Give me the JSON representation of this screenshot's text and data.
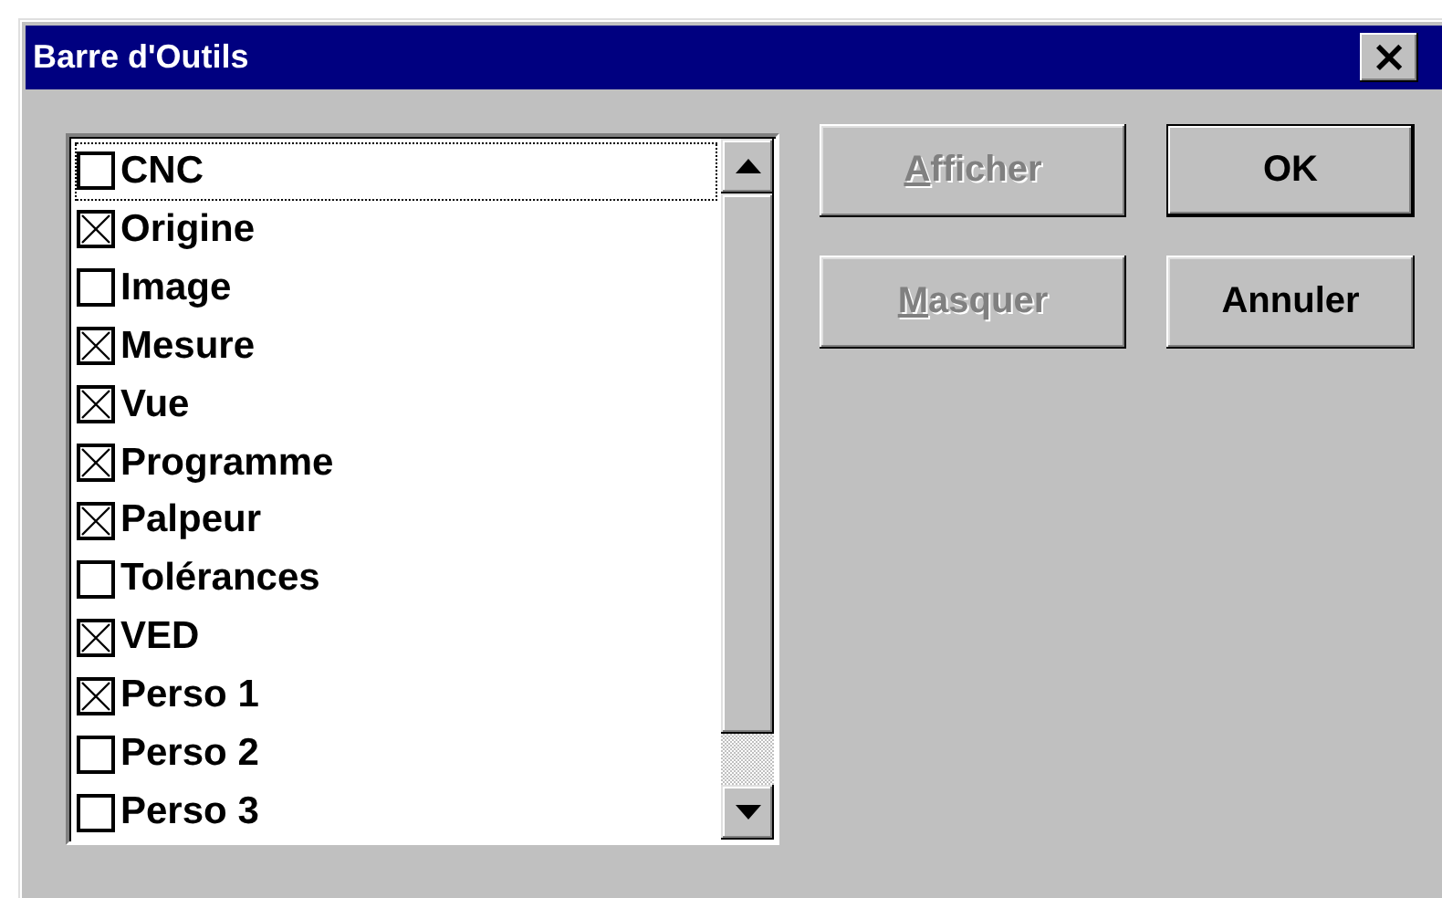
{
  "window": {
    "title": "Barre d'Outils",
    "close_label": "×"
  },
  "list": {
    "items": [
      {
        "label": "CNC",
        "checked": false,
        "focused": true
      },
      {
        "label": "Origine",
        "checked": true,
        "focused": false
      },
      {
        "label": "Image",
        "checked": false,
        "focused": false
      },
      {
        "label": "Mesure",
        "checked": true,
        "focused": false
      },
      {
        "label": "Vue",
        "checked": true,
        "focused": false
      },
      {
        "label": "Programme",
        "checked": true,
        "focused": false
      },
      {
        "label": "Palpeur",
        "checked": true,
        "focused": false
      },
      {
        "label": "Tolérances",
        "checked": false,
        "focused": false
      },
      {
        "label": "VED",
        "checked": true,
        "focused": false
      },
      {
        "label": "Perso 1",
        "checked": true,
        "focused": false
      },
      {
        "label": "Perso 2",
        "checked": false,
        "focused": false
      },
      {
        "label": "Perso 3",
        "checked": false,
        "focused": false
      }
    ]
  },
  "buttons": [
    {
      "label": "Afficher",
      "disabled": true,
      "default": false,
      "underline_first": true
    },
    {
      "label": "OK",
      "disabled": false,
      "default": true,
      "underline_first": false
    },
    {
      "label": "Masquer",
      "disabled": true,
      "default": false,
      "underline_first": true
    },
    {
      "label": "Annuler",
      "disabled": false,
      "default": false,
      "underline_first": false
    }
  ]
}
